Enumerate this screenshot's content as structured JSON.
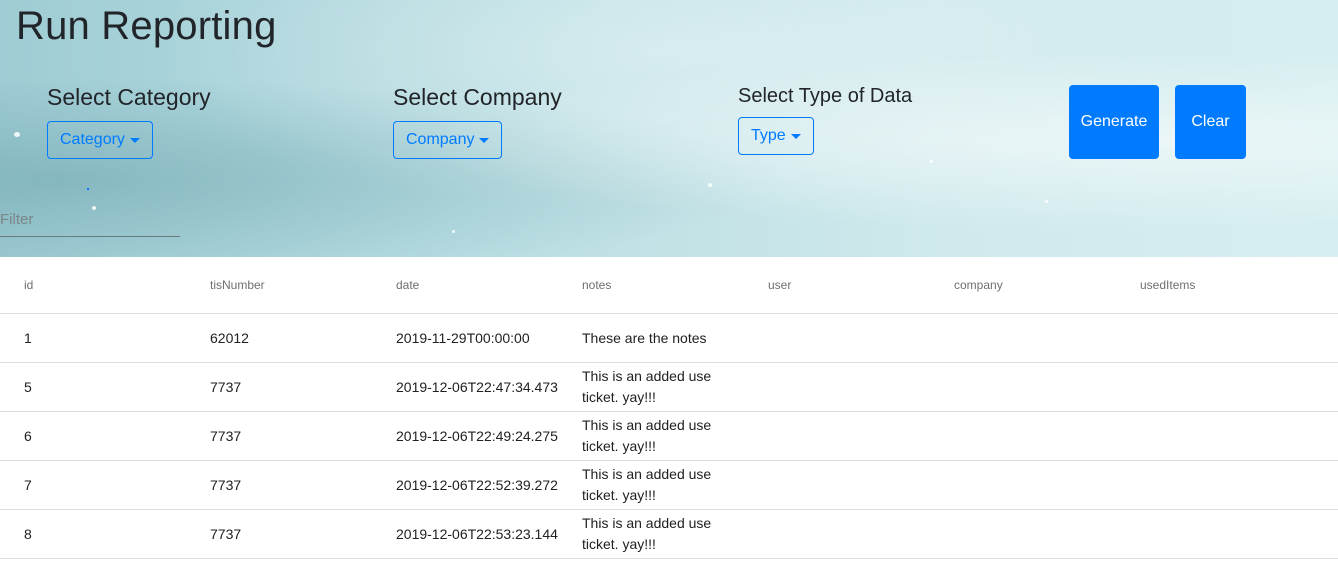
{
  "page": {
    "title": "Run Reporting"
  },
  "filters": {
    "category": {
      "heading": "Select Category",
      "button_label": "Category"
    },
    "company": {
      "heading": "Select Company",
      "button_label": "Company"
    },
    "type": {
      "heading": "Select Type of Data",
      "button_label": "Type"
    }
  },
  "actions": {
    "generate_label": "Generate",
    "clear_label": "Clear"
  },
  "search": {
    "placeholder": "Filter",
    "value": ""
  },
  "colors": {
    "accent": "#007bff",
    "title_text": "#212529"
  },
  "table": {
    "columns": [
      "id",
      "tisNumber",
      "date",
      "notes",
      "user",
      "company",
      "usedItems"
    ],
    "rows": [
      {
        "id": "1",
        "tisNumber": "62012",
        "date": "2019-11-29T00:00:00",
        "notes": "These are the notes",
        "user": "",
        "company": "",
        "usedItems": ""
      },
      {
        "id": "5",
        "tisNumber": "7737",
        "date": "2019-12-06T22:47:34.473",
        "notes": "This is an added use ticket. yay!!!",
        "user": "",
        "company": "",
        "usedItems": ""
      },
      {
        "id": "6",
        "tisNumber": "7737",
        "date": "2019-12-06T22:49:24.275",
        "notes": "This is an added use ticket. yay!!!",
        "user": "",
        "company": "",
        "usedItems": ""
      },
      {
        "id": "7",
        "tisNumber": "7737",
        "date": "2019-12-06T22:52:39.272",
        "notes": "This is an added use ticket. yay!!!",
        "user": "",
        "company": "",
        "usedItems": ""
      },
      {
        "id": "8",
        "tisNumber": "7737",
        "date": "2019-12-06T22:53:23.144",
        "notes": "This is an added use ticket. yay!!!",
        "user": "",
        "company": "",
        "usedItems": ""
      }
    ]
  }
}
